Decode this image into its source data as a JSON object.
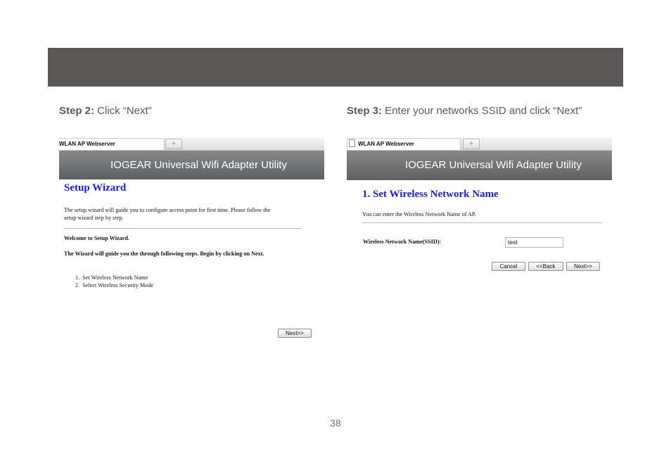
{
  "step2": {
    "label": "Step 2:",
    "text": " Click “Next”"
  },
  "step3": {
    "label": "Step 3:",
    "text": " Enter your networks SSID and click “Next”"
  },
  "left_screenshot": {
    "tab_title": "WLAN AP Webserver",
    "new_tab_symbol": "+",
    "banner": "IOGEAR Universal Wifi Adapter Utility",
    "heading": "Setup Wizard",
    "intro_line1": "The setup wizard will guide you to configure access point for first time. Please follow the",
    "intro_line2": "setup wizard step by step.",
    "welcome": "Welcome to Setup Wizard.",
    "guide": "The Wizard will guide you the through following steps. Begin by clicking on Next.",
    "steps": [
      "Set Wireless Network Name",
      "Select Wireless Security Mode"
    ],
    "next_button": "Next>>"
  },
  "right_screenshot": {
    "tab_title": "WLAN AP Webserver",
    "new_tab_symbol": "+",
    "banner": "IOGEAR Universal Wifi Adapter Utility",
    "heading": "1. Set Wireless Network Name",
    "intro": "You can enter the Wireless Network Name of AP.",
    "ssid_label": "Wireless Network Name(SSID):",
    "ssid_value": "test",
    "cancel_button": "Cancel",
    "back_button": "<<Back",
    "next_button": "Next>>"
  },
  "page_number": "38"
}
